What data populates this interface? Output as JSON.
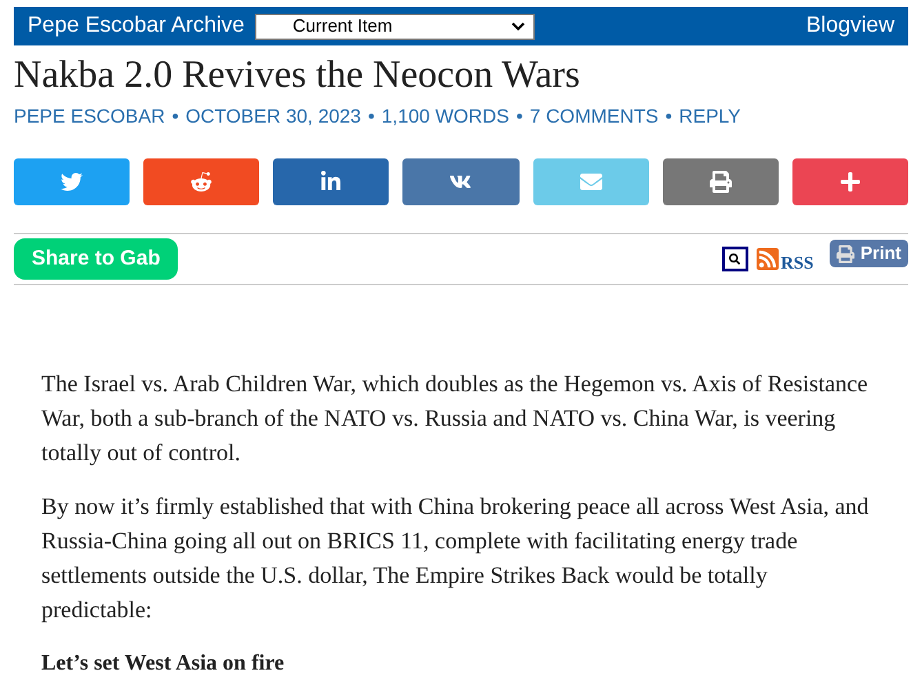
{
  "header": {
    "site_title": "Pepe Escobar Archive",
    "select_value": "Current Item",
    "blogview": "Blogview"
  },
  "article": {
    "title": "Nakba 2.0 Revives the Neocon Wars",
    "meta": [
      {
        "kind": "link",
        "text": "PEPE ESCOBAR"
      },
      {
        "kind": "separator",
        "text": "•"
      },
      {
        "kind": "link",
        "text": "OCTOBER 30, 2023"
      },
      {
        "kind": "separator",
        "text": "•"
      },
      {
        "kind": "link",
        "text": "1,100 WORDS"
      },
      {
        "kind": "separator",
        "text": "•"
      },
      {
        "kind": "link",
        "text": "7 COMMENTS"
      },
      {
        "kind": "separator",
        "text": "•"
      },
      {
        "kind": "link",
        "text": "REPLY"
      }
    ]
  },
  "share_buttons": [
    {
      "kind": "twitter",
      "color": "#1da1f2"
    },
    {
      "kind": "reddit",
      "color": "#f14b22"
    },
    {
      "kind": "linkedin",
      "color": "#2767ab"
    },
    {
      "kind": "vk",
      "color": "#4a76a8"
    },
    {
      "kind": "email",
      "color": "#6ccbe9"
    },
    {
      "kind": "print",
      "color": "#777777"
    },
    {
      "kind": "more",
      "color": "#eb4553"
    }
  ],
  "tools": {
    "gab_button": "Share to Gab",
    "rss": "RSS",
    "print": "Print"
  },
  "body": [
    {
      "kind": "paragraph",
      "text": "The Israel vs. Arab Children War, which doubles as the Hegemon vs. Axis of Resistance War, both a sub-branch of the NATO vs. Russia and NATO vs. China War, is veering totally out of control."
    },
    {
      "kind": "paragraph",
      "text": "By now it’s firmly established that with China brokering peace all across West Asia, and Russia-China going all out on BRICS 11, complete with facilitating energy trade settlements outside the U.S. dollar, The Empire Strikes Back would be totally predictable:"
    },
    {
      "kind": "heading",
      "text": "Let’s set West Asia on fire"
    }
  ]
}
